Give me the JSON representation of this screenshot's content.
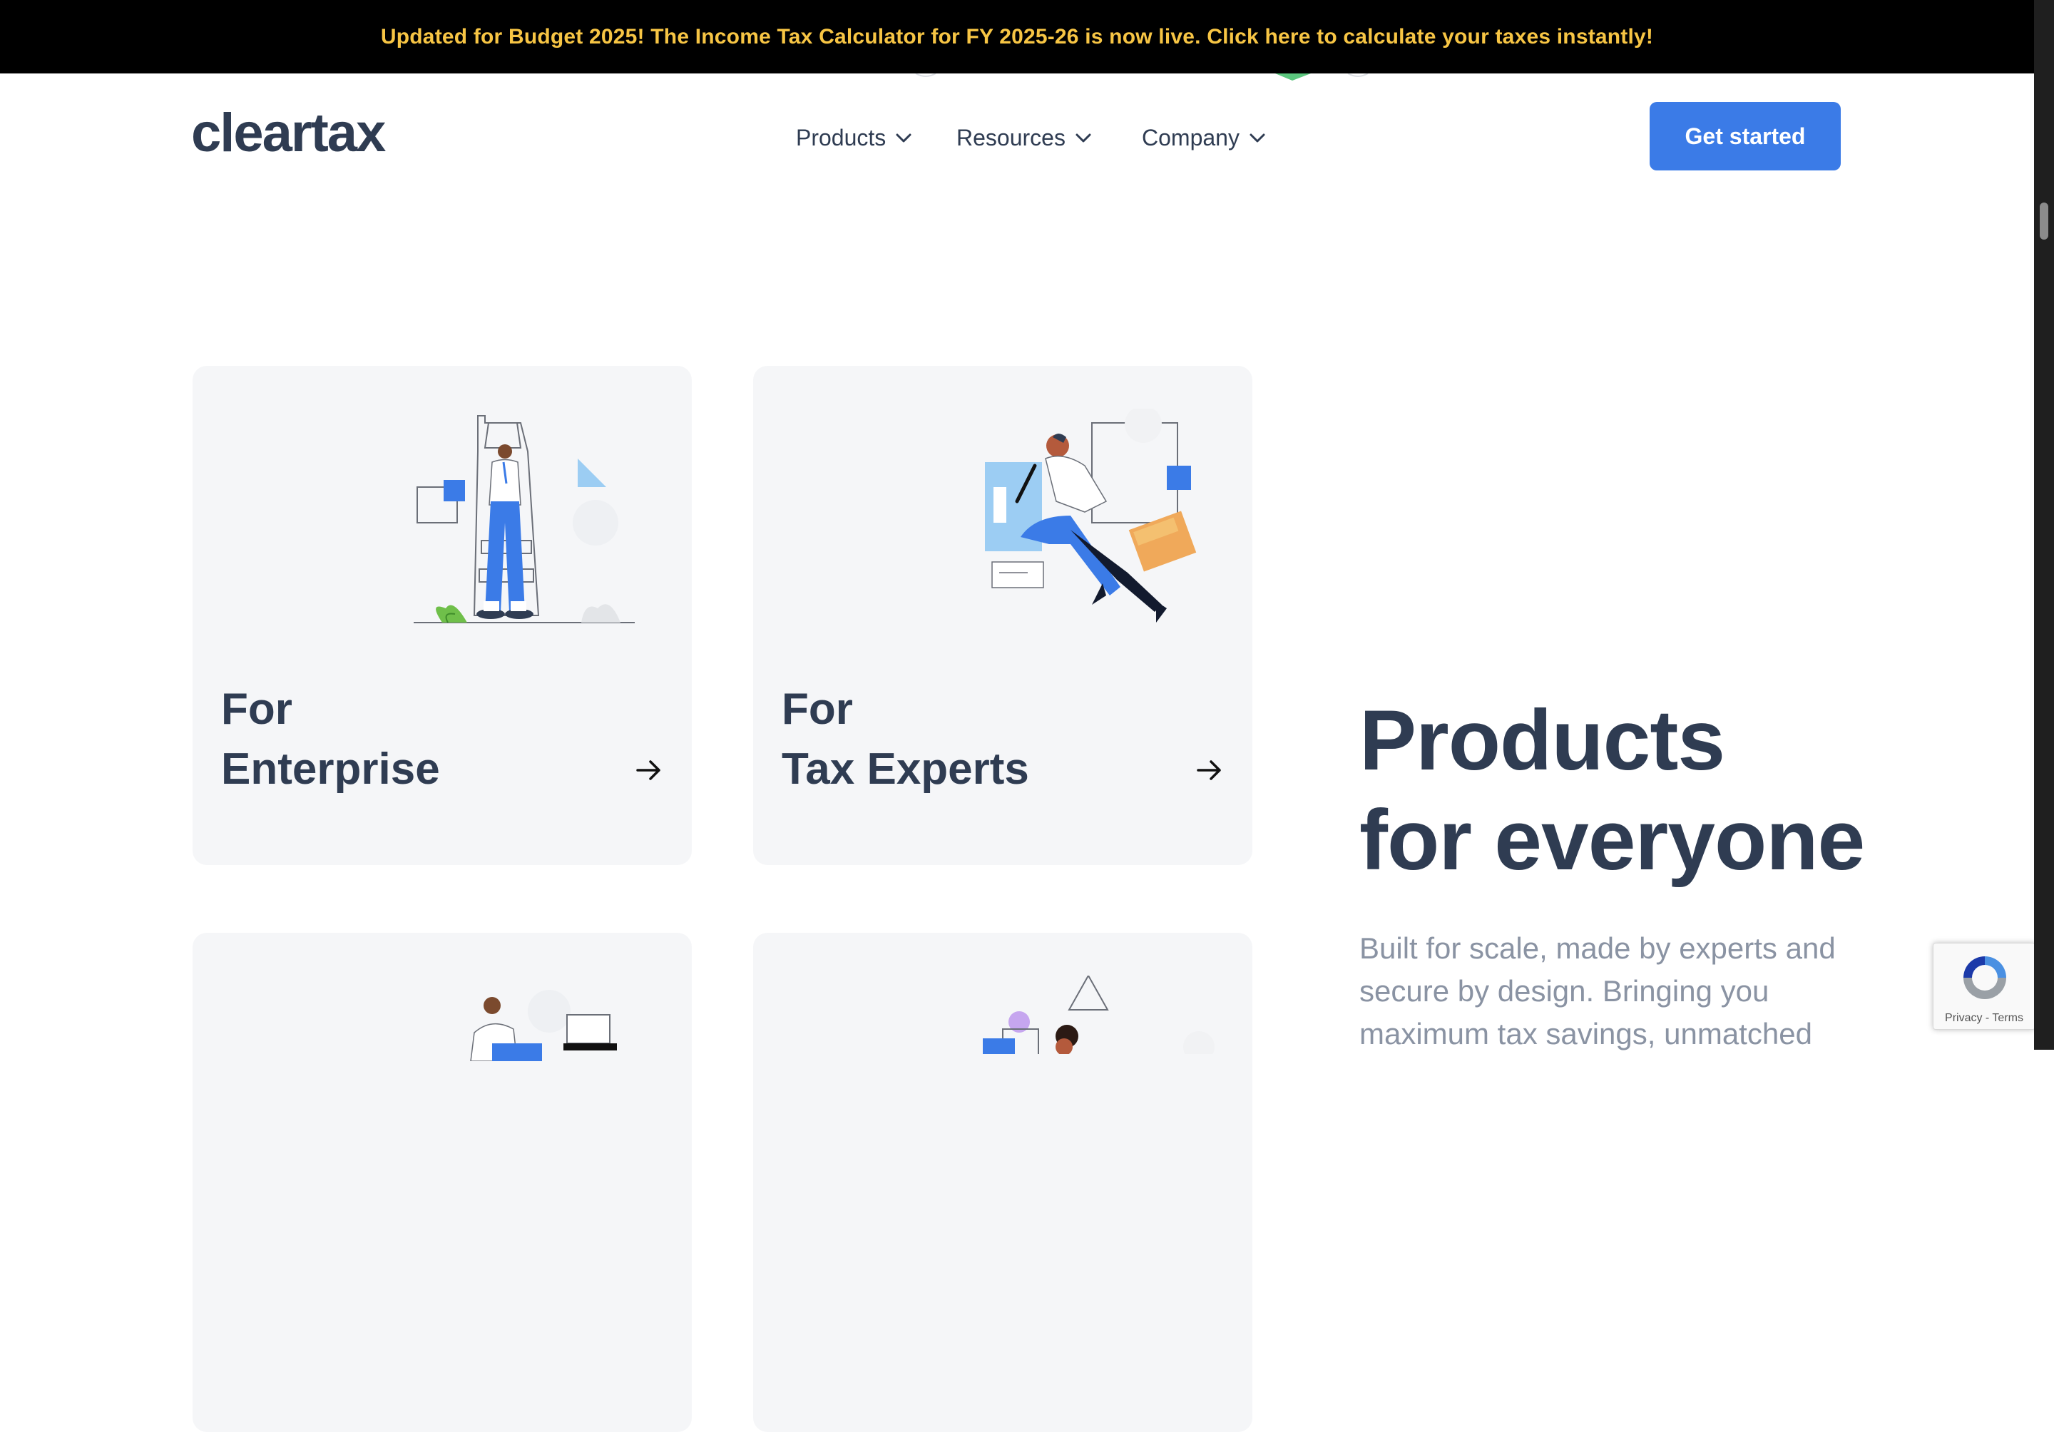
{
  "announcement": {
    "text": "Updated for Budget 2025! The Income Tax Calculator for FY 2025-26 is now live. Click here to calculate your taxes instantly!",
    "text_color": "#f7c544",
    "background": "#000000"
  },
  "header": {
    "logo": "cleartax",
    "nav": [
      {
        "label": "Products",
        "icon": "chevron-down-icon"
      },
      {
        "label": "Resources",
        "icon": "chevron-down-icon"
      },
      {
        "label": "Company",
        "icon": "chevron-down-icon"
      }
    ],
    "cta_label": "Get started",
    "cta_color": "#3b7be7"
  },
  "cards": [
    {
      "line1": "For",
      "line2": "Enterprise",
      "icon": "arrow-right-icon"
    },
    {
      "line1": "For",
      "line2": "Tax Experts",
      "icon": "arrow-right-icon"
    }
  ],
  "hero": {
    "title_line1": "Products",
    "title_line2": "for everyone",
    "description": "Built for scale, made by experts and secure by design. Bringing you maximum tax savings, unmatched"
  },
  "recaptcha": {
    "links": "Privacy - Terms"
  }
}
